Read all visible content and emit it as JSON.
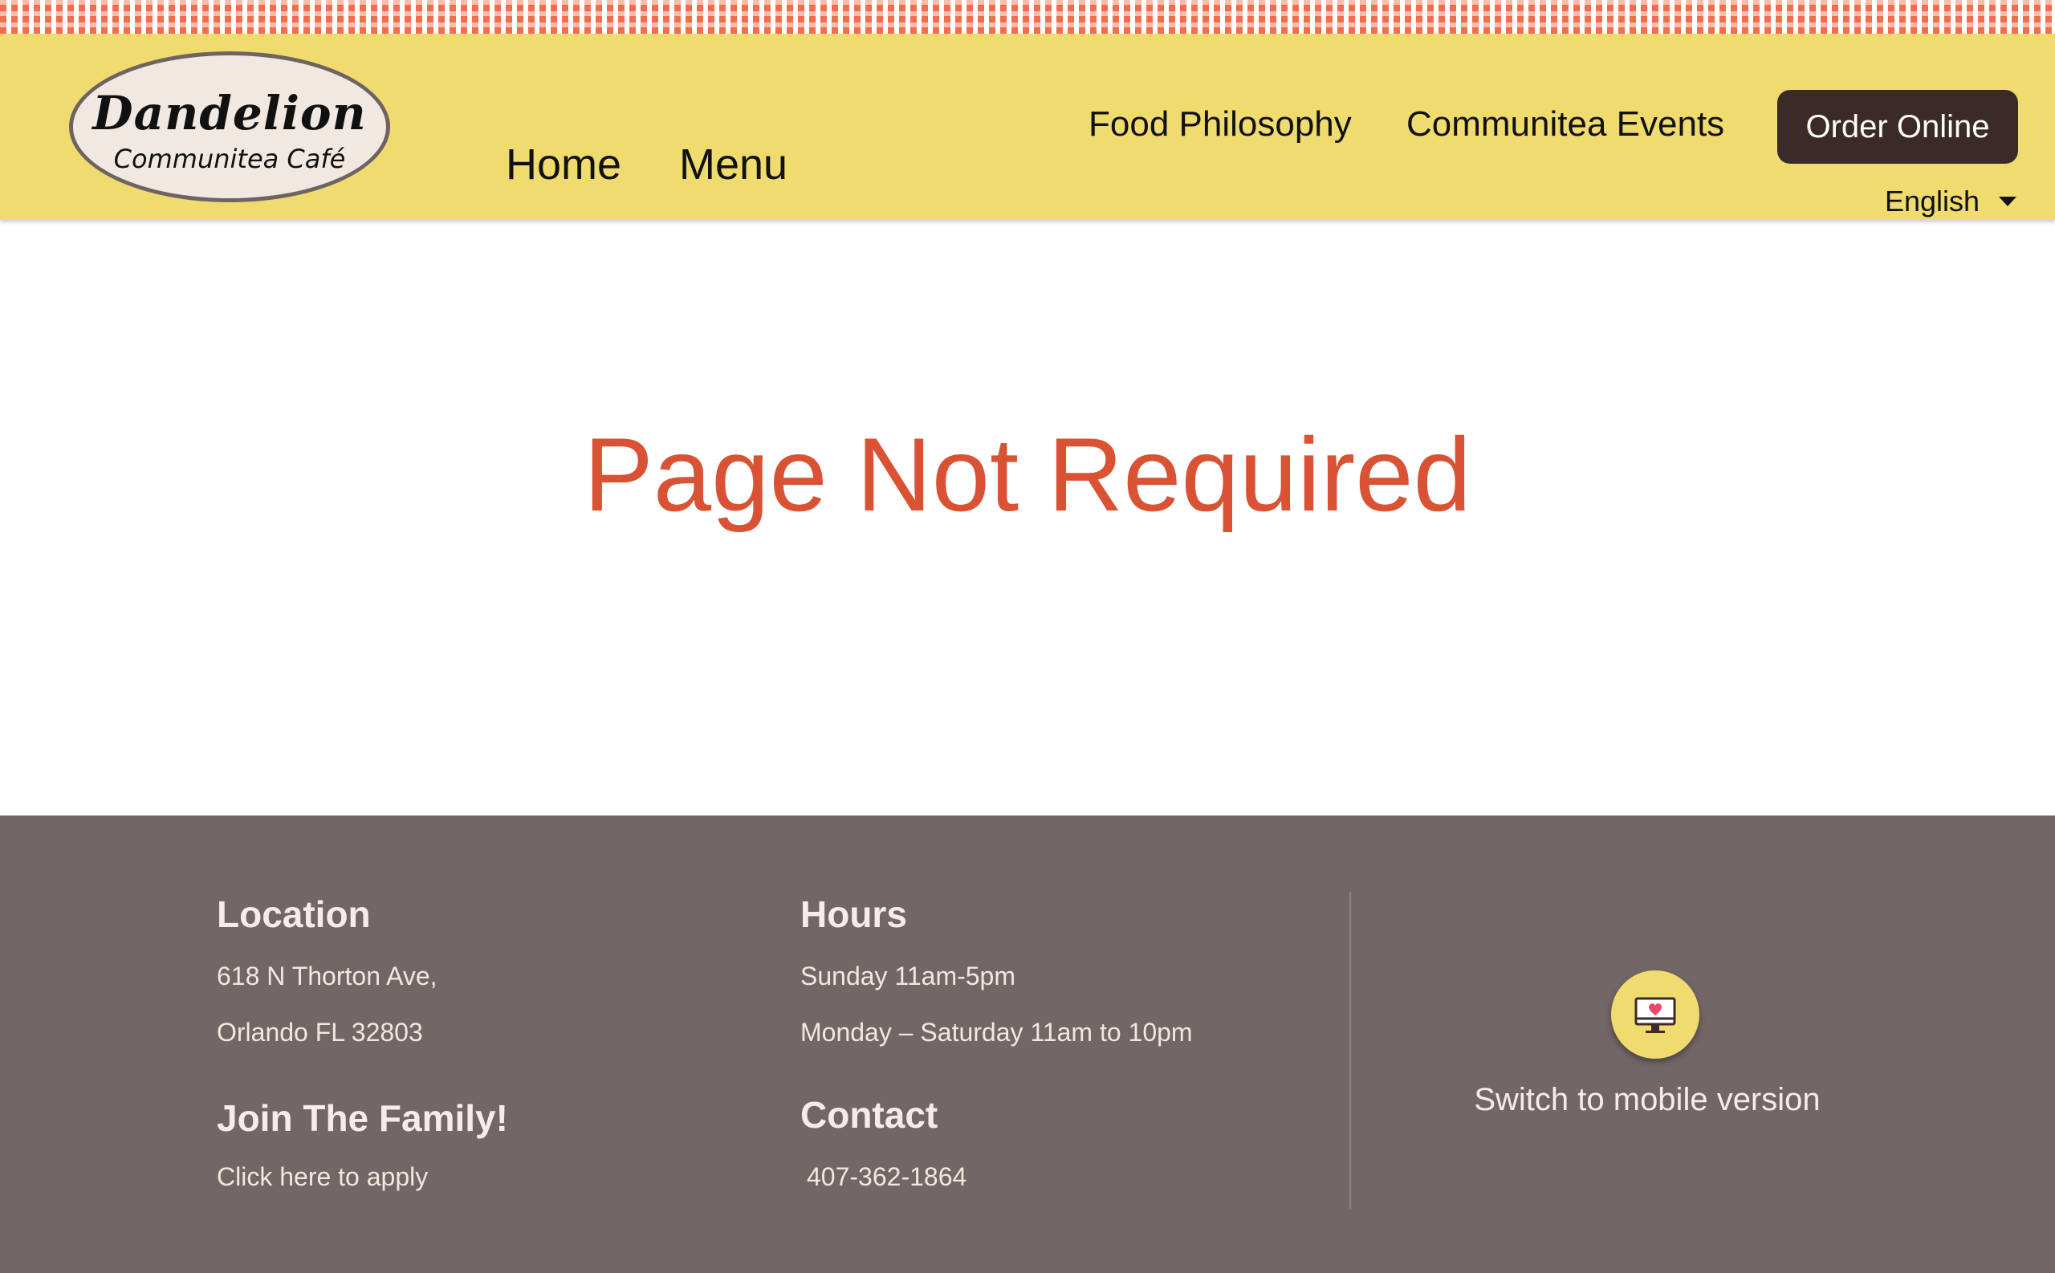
{
  "brand": {
    "name": "Dandelion",
    "subtitle": "Communitea Café"
  },
  "nav": {
    "home": "Home",
    "menu": "Menu",
    "food_philosophy": "Food Philosophy",
    "events": "Communitea Events",
    "order_online": "Order Online",
    "language": "English"
  },
  "main": {
    "title": "Page Not Required"
  },
  "footer": {
    "location": {
      "heading": "Location",
      "line1": "618 N Thorton Ave,",
      "line2": "Orlando FL 32803"
    },
    "hours": {
      "heading": "Hours",
      "line1": "Sunday 11am-5pm",
      "line2": "Monday – Saturday 11am to 10pm"
    },
    "join": {
      "heading": "Join The Family!",
      "link": "Click here to apply"
    },
    "contact": {
      "heading": "Contact",
      "phone": "407-362-1864"
    },
    "mobile": {
      "icon": "monitor-heart-icon",
      "label": "Switch to mobile version"
    }
  },
  "colors": {
    "header_bg": "#f0db6e",
    "gingham": "#f26d4b",
    "order_button": "#3b2a27",
    "title": "#d95234",
    "footer_bg": "#736666"
  }
}
